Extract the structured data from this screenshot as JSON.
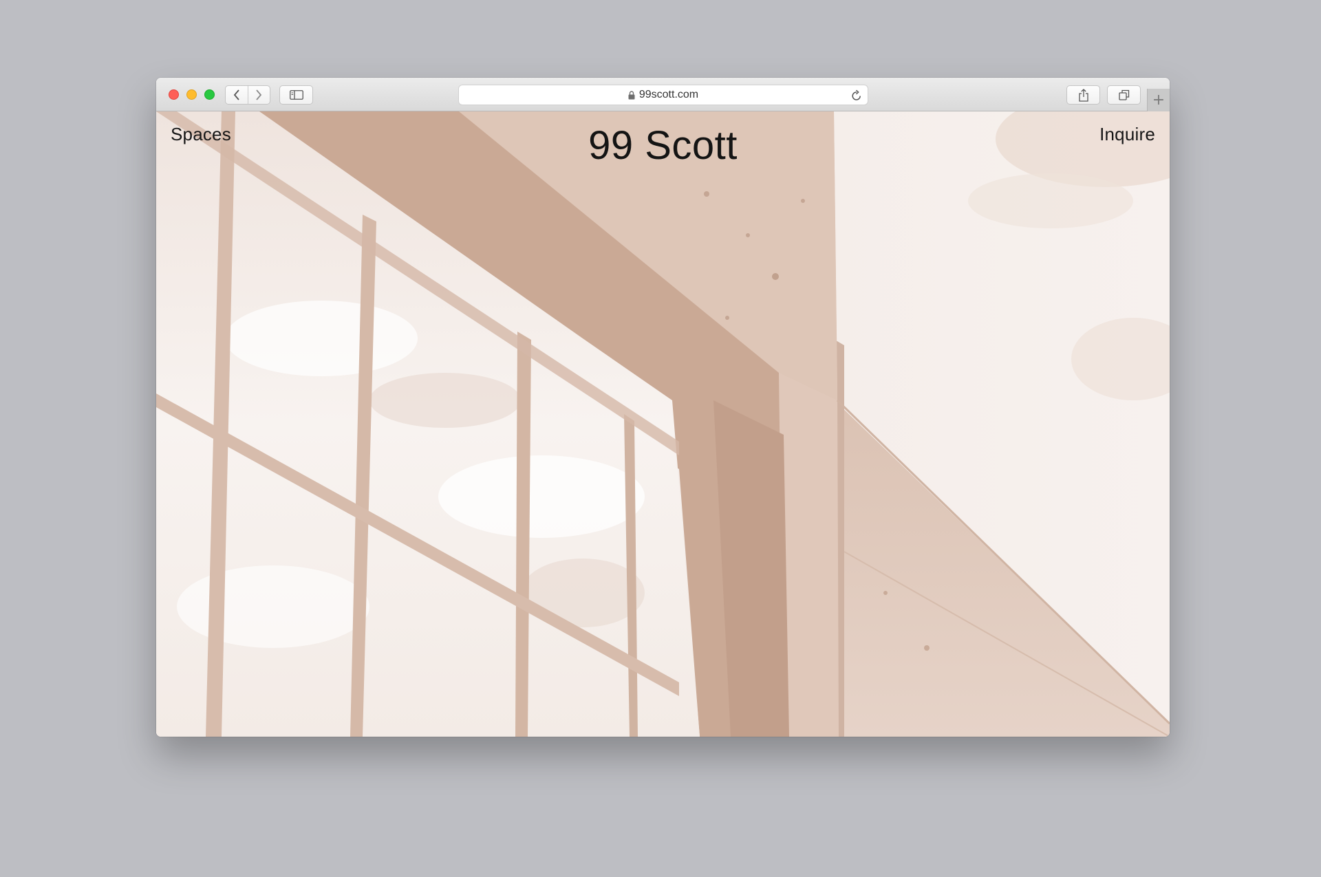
{
  "browser": {
    "url": "99scott.com",
    "new_tab_label": "+"
  },
  "site": {
    "title": "99 Scott",
    "nav_left": "Spaces",
    "nav_right": "Inquire"
  },
  "colors": {
    "tint": "#c9ac9b",
    "sky": "#f6efeb",
    "text": "#141414"
  },
  "icons": {
    "back": "chevron-left-icon",
    "forward": "chevron-right-icon",
    "sidebar": "sidebar-icon",
    "lock": "lock-icon",
    "reload": "reload-icon",
    "share": "share-icon",
    "tabs": "tabs-icon"
  }
}
